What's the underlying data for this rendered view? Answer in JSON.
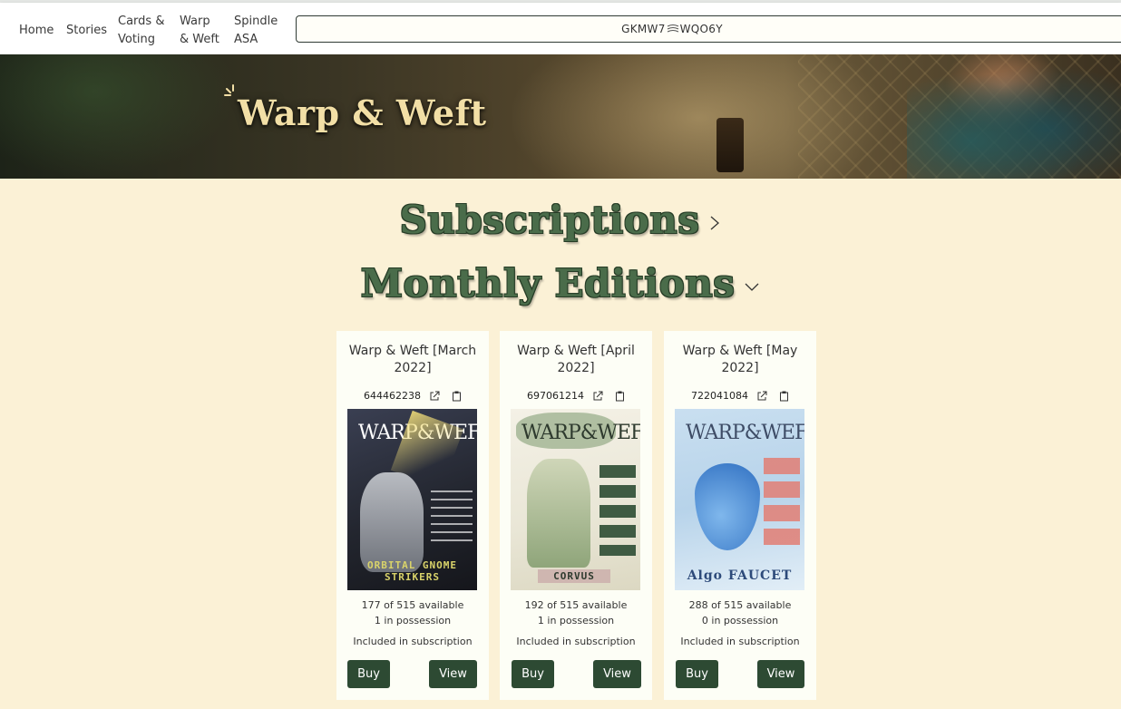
{
  "nav": {
    "home": "Home",
    "stories": "Stories",
    "cards_line1": "Cards &",
    "cards_line2": "Voting",
    "warp_line1": "Warp",
    "warp_line2": "& Weft",
    "spindle_line1": "Spindle",
    "spindle_line2": "ASA",
    "wallet_left": "GKMW7",
    "wallet_right": "WQO6Y"
  },
  "banner": {
    "title": "Warp & Weft"
  },
  "sections": {
    "subscriptions": "Subscriptions",
    "monthly": "Monthly Editions"
  },
  "editions": [
    {
      "title": "Warp & Weft [March 2022]",
      "asset_id": "644462238",
      "cover_brand": "WARP&WEFT",
      "cover_footer": "ORBITAL GNOME STRIKERS",
      "available": "177 of 515 available",
      "possession": "1 in possession",
      "subscription": "Included in subscription",
      "buy": "Buy",
      "view": "View"
    },
    {
      "title": "Warp & Weft [April 2022]",
      "asset_id": "697061214",
      "cover_brand": "WARP&WEFT",
      "cover_footer": "CORVUS",
      "available": "192 of 515 available",
      "possession": "1 in possession",
      "subscription": "Included in subscription",
      "buy": "Buy",
      "view": "View"
    },
    {
      "title": "Warp & Weft [May 2022]",
      "asset_id": "722041084",
      "cover_brand": "WARP&WEFT",
      "cover_footer": "Algo FAUCET",
      "available": "288 of 515 available",
      "possession": "0 in possession",
      "subscription": "Included in subscription",
      "buy": "Buy",
      "view": "View"
    }
  ],
  "colors": {
    "background": "#fbf1d6",
    "heading_green": "#4a6c4a",
    "button_green": "#2d4a33",
    "card_bg": "#fdfef6"
  }
}
